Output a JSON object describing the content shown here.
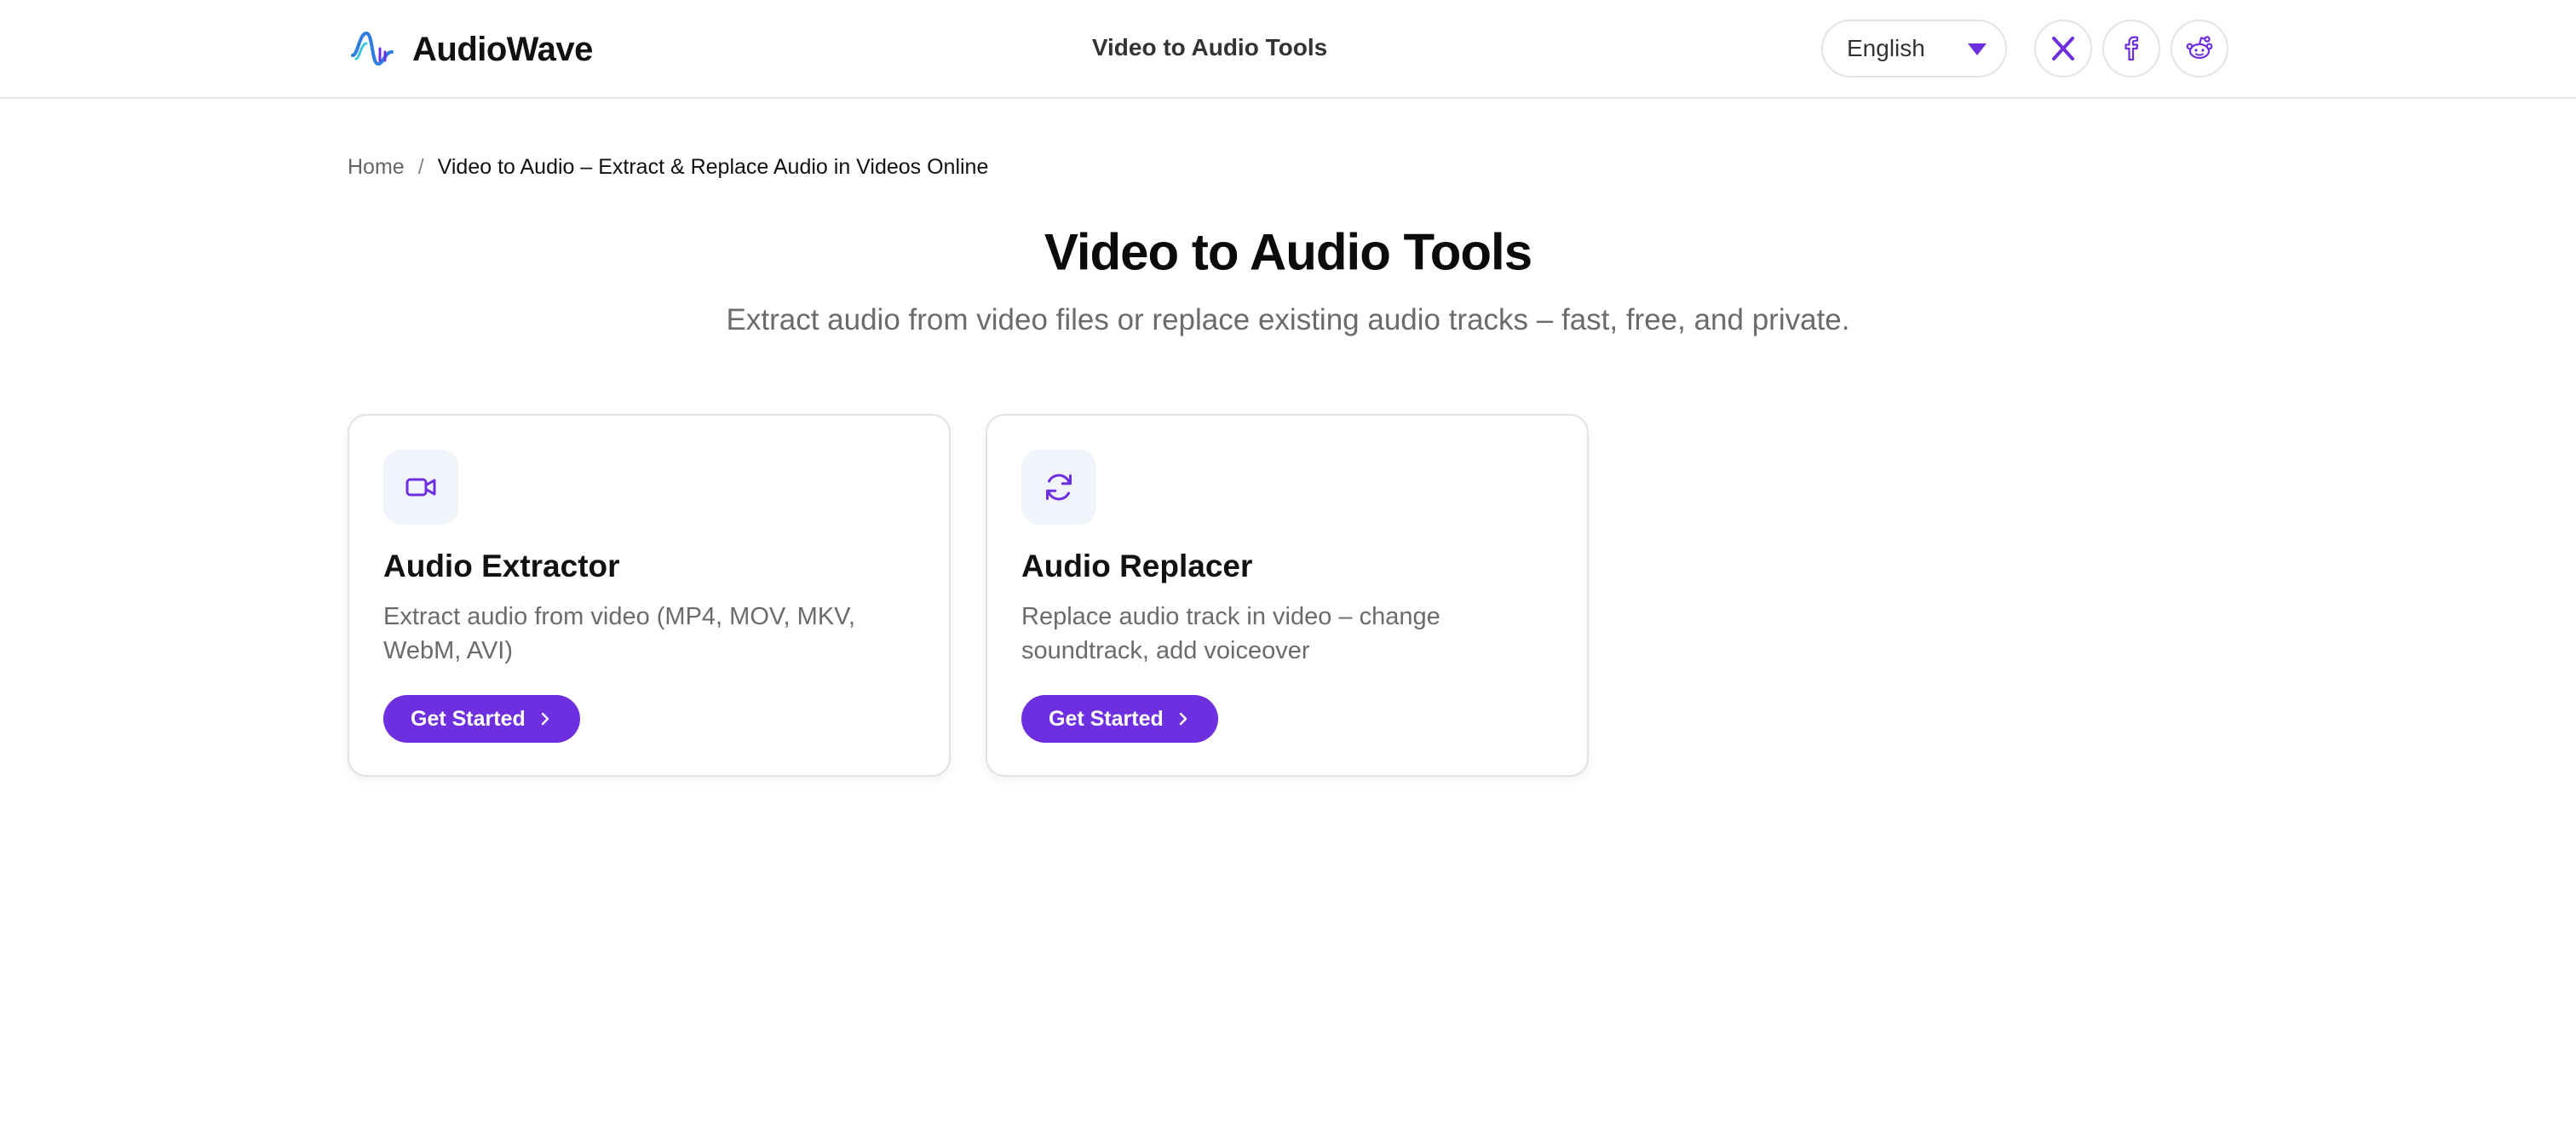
{
  "header": {
    "brand": "AudioWave",
    "title": "Video to Audio Tools",
    "language": "English"
  },
  "breadcrumb": {
    "home": "Home",
    "separator": "/",
    "current": "Video to Audio – Extract & Replace Audio in Videos Online"
  },
  "hero": {
    "title": "Video to Audio Tools",
    "subtitle": "Extract audio from video files or replace existing audio tracks – fast, free, and private."
  },
  "cards": [
    {
      "icon": "video-camera-icon",
      "title": "Audio Extractor",
      "description": "Extract audio from video (MP4, MOV, MKV, WebM, AVI)",
      "button": "Get Started"
    },
    {
      "icon": "refresh-icon",
      "title": "Audio Replacer",
      "description": "Replace audio track in video – change soundtrack, add voiceover",
      "button": "Get Started"
    }
  ],
  "colors": {
    "accent": "#6d2fe0",
    "icon_bg": "#f1f4fb",
    "logo_blue": "#2f7de1",
    "logo_cyan": "#3ec6e0"
  }
}
